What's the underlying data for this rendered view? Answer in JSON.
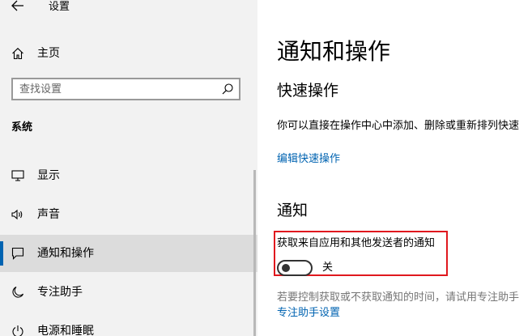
{
  "window": {
    "title": "设置"
  },
  "sidebar": {
    "home_label": "主页",
    "search": {
      "placeholder": "查找设置",
      "value": ""
    },
    "section_label": "系统",
    "items": [
      {
        "label": "显示",
        "icon": "monitor-icon",
        "selected": false
      },
      {
        "label": "声音",
        "icon": "speaker-icon",
        "selected": false
      },
      {
        "label": "通知和操作",
        "icon": "notification-icon",
        "selected": true
      },
      {
        "label": "专注助手",
        "icon": "moon-icon",
        "selected": false
      },
      {
        "label": "电源和睡眠",
        "icon": "power-icon",
        "selected": false
      }
    ]
  },
  "main": {
    "page_title": "通知和操作",
    "quick_actions": {
      "heading": "快速操作",
      "description": "你可以直接在操作中心中添加、删除或重新排列快速",
      "edit_link": "编辑快速操作"
    },
    "notifications": {
      "heading": "通知",
      "toggle_label": "获取来自应用和其他发送者的通知",
      "toggle_state": "关",
      "toggle_on": false,
      "hint": "若要控制获取或不获取通知的时间，请试用专注助手",
      "focus_link": "专注助手设置"
    }
  },
  "colors": {
    "accent": "#0063b1",
    "sidebar_bg": "#f2f2f2",
    "selected_bg": "#dcdcdc",
    "highlight_border": "#e0181e"
  }
}
